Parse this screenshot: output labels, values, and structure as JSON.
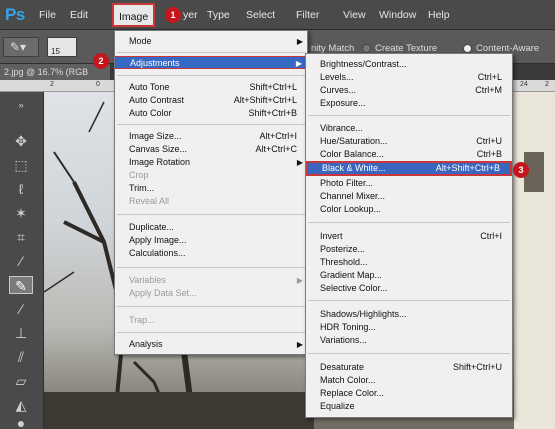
{
  "app": {
    "logo": "Ps"
  },
  "menubar": {
    "items": [
      "File",
      "Edit",
      "Image",
      "yer",
      "Type",
      "Select",
      "Filter",
      "View",
      "Window",
      "Help"
    ]
  },
  "steps": [
    "1",
    "2",
    "3"
  ],
  "options_bar": {
    "size_value": "15",
    "text_partial": "nity Match",
    "radio_create_texture": "Create Texture",
    "radio_content_aware": "Content-Aware"
  },
  "document": {
    "tab_label": "2.jpg @ 16.7% (RGB",
    "ruler_marks": [
      "2",
      "0",
      "24",
      "2"
    ]
  },
  "image_menu": {
    "items": [
      {
        "label": "Mode",
        "shortcut": "",
        "submenu": true,
        "disabled": false
      },
      {
        "label": "Adjustments",
        "shortcut": "",
        "submenu": true,
        "disabled": false,
        "highlighted": true
      },
      {
        "label": "Auto Tone",
        "shortcut": "Shift+Ctrl+L",
        "disabled": false
      },
      {
        "label": "Auto Contrast",
        "shortcut": "Alt+Shift+Ctrl+L",
        "disabled": false
      },
      {
        "label": "Auto Color",
        "shortcut": "Shift+Ctrl+B",
        "disabled": false
      },
      {
        "label": "Image Size...",
        "shortcut": "Alt+Ctrl+I",
        "disabled": false
      },
      {
        "label": "Canvas Size...",
        "shortcut": "Alt+Ctrl+C",
        "disabled": false
      },
      {
        "label": "Image Rotation",
        "shortcut": "",
        "submenu": true,
        "disabled": false
      },
      {
        "label": "Crop",
        "shortcut": "",
        "disabled": true
      },
      {
        "label": "Trim...",
        "shortcut": "",
        "disabled": false
      },
      {
        "label": "Reveal All",
        "shortcut": "",
        "disabled": true
      },
      {
        "label": "Duplicate...",
        "shortcut": "",
        "disabled": false
      },
      {
        "label": "Apply Image...",
        "shortcut": "",
        "disabled": false
      },
      {
        "label": "Calculations...",
        "shortcut": "",
        "disabled": false
      },
      {
        "label": "Variables",
        "shortcut": "",
        "submenu": true,
        "disabled": true
      },
      {
        "label": "Apply Data Set...",
        "shortcut": "",
        "disabled": true
      },
      {
        "label": "Trap...",
        "shortcut": "",
        "disabled": true
      },
      {
        "label": "Analysis",
        "shortcut": "",
        "submenu": true,
        "disabled": false
      }
    ]
  },
  "adjustments_menu": {
    "items": [
      {
        "label": "Brightness/Contrast...",
        "shortcut": ""
      },
      {
        "label": "Levels...",
        "shortcut": "Ctrl+L"
      },
      {
        "label": "Curves...",
        "shortcut": "Ctrl+M"
      },
      {
        "label": "Exposure...",
        "shortcut": ""
      },
      {
        "label": "Vibrance...",
        "shortcut": ""
      },
      {
        "label": "Hue/Saturation...",
        "shortcut": "Ctrl+U"
      },
      {
        "label": "Color Balance...",
        "shortcut": "Ctrl+B"
      },
      {
        "label": "Black & White...",
        "shortcut": "Alt+Shift+Ctrl+B",
        "highlighted": true
      },
      {
        "label": "Photo Filter...",
        "shortcut": ""
      },
      {
        "label": "Channel Mixer...",
        "shortcut": ""
      },
      {
        "label": "Color Lookup...",
        "shortcut": ""
      },
      {
        "label": "Invert",
        "shortcut": "Ctrl+I"
      },
      {
        "label": "Posterize...",
        "shortcut": ""
      },
      {
        "label": "Threshold...",
        "shortcut": ""
      },
      {
        "label": "Gradient Map...",
        "shortcut": ""
      },
      {
        "label": "Selective Color...",
        "shortcut": ""
      },
      {
        "label": "Shadows/Highlights...",
        "shortcut": ""
      },
      {
        "label": "HDR Toning...",
        "shortcut": ""
      },
      {
        "label": "Variations...",
        "shortcut": ""
      },
      {
        "label": "Desaturate",
        "shortcut": "Shift+Ctrl+U"
      },
      {
        "label": "Match Color...",
        "shortcut": ""
      },
      {
        "label": "Replace Color...",
        "shortcut": ""
      },
      {
        "label": "Equalize",
        "shortcut": ""
      }
    ]
  },
  "colors": {
    "accent": "#c8373a",
    "highlight": "#3669c4",
    "brand": "#38a2e8"
  }
}
